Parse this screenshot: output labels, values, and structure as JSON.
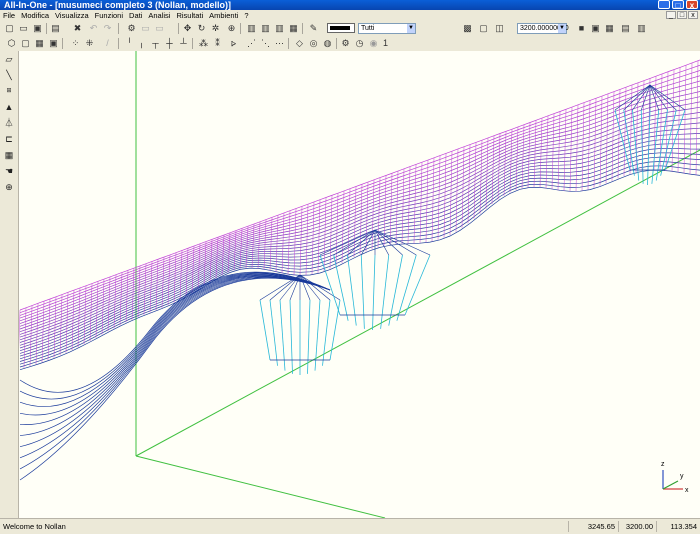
{
  "window": {
    "title": "All-In-One - [musumeci completo 3 (Nollan, modello)]",
    "minimize_glyph": "_",
    "maximize_glyph": "□",
    "close_glyph": "x"
  },
  "menu": {
    "items": [
      "File",
      "Modifica",
      "Visualizza",
      "Funzioni",
      "Dati",
      "Analisi",
      "Risultati",
      "Ambienti",
      "?"
    ]
  },
  "toolbar": {
    "filter_value": "Tutti",
    "zoom_value": "3200.00000000",
    "counter_value": "1"
  },
  "icons": {
    "row1": [
      "new-icon",
      "open-icon",
      "save-icon",
      "print-icon",
      "cut-icon",
      "undo-icon",
      "redo-icon",
      "copy-icon",
      "paste-icon",
      "select-icon",
      "rotate-icon",
      "orbit-icon",
      "zoom-icon",
      "view-x-icon",
      "view-y-icon",
      "view-z-icon",
      "view-3d-icon",
      "pen-icon"
    ],
    "row2": [
      "box-icon",
      "cube-icon",
      "grid-icon",
      "layers-icon",
      "node-icon",
      "node-add-icon",
      "line-icon",
      "beam-icon",
      "support-icon",
      "load-icon",
      "hinge-icon",
      "axis-icon",
      "mesh-icon",
      "surface-icon",
      "force-icon",
      "moment-icon",
      "spring-icon",
      "constraint-icon",
      "clock-icon",
      "play-icon"
    ]
  },
  "left_tools": [
    "plane-icon",
    "line-tool-icon",
    "node-tool-icon",
    "shell-icon",
    "support-tool-icon",
    "dimension-icon",
    "grid-tool-icon",
    "hand-icon",
    "magnify-icon"
  ],
  "axes": {
    "z": "z",
    "y": "y",
    "x": "x"
  },
  "colors": {
    "mesh_top": "#c040d8",
    "mesh_bottom": "#1a3a9a",
    "mesh_cyan": "#28b8d8",
    "guide_green": "#40c040"
  },
  "status": {
    "message": "Welcome to Nollan",
    "coord_x": "3245.65",
    "coord_y": "3200.00",
    "coord_z": "113.354"
  }
}
